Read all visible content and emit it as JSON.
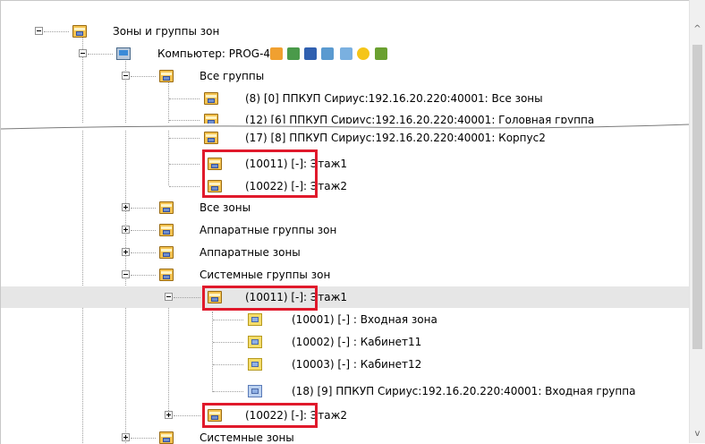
{
  "tree": {
    "root": "Зоны и группы зон",
    "computer": "Компьютер: PROG-43",
    "all_groups": "Все группы",
    "groups": [
      "(8) [0] ППКУП Сириус:192.16.20.220:40001: Все зоны",
      "(12) [6] ППКУП Сириус:192.16.20.220:40001: Головная группа",
      "(17) [8] ППКУП Сириус:192.16.20.220:40001: Корпус2",
      "(10011) [-]: Этаж1",
      "(10022) [-]: Этаж2"
    ],
    "all_zones": "Все зоны",
    "hw_groups": "Аппаратные группы зон",
    "hw_zones": "Аппаратные зоны",
    "sys_groups": "Системные группы зон",
    "sys_group1": "(10011) [-]: Этаж1",
    "sys_group1_children": [
      "(10001) [-] : Входная зона",
      "(10002) [-] : Кабинет11",
      "(10003) [-] : Кабинет12",
      "(18) [9] ППКУП Сириус:192.16.20.220:40001: Входная группа"
    ],
    "sys_group2": "(10022) [-]: Этаж2",
    "sys_zones": "Системные зоны"
  },
  "toolbar_icons": [
    "filter-icon",
    "monitor-icon",
    "server-icon",
    "network-icon",
    "database-icon",
    "sun-icon",
    "users-icon"
  ],
  "colors": {
    "highlight_box": "#e0192b",
    "selected_row": "#e6e6e6"
  },
  "scrollbar": {
    "up": "^",
    "down": "v"
  }
}
